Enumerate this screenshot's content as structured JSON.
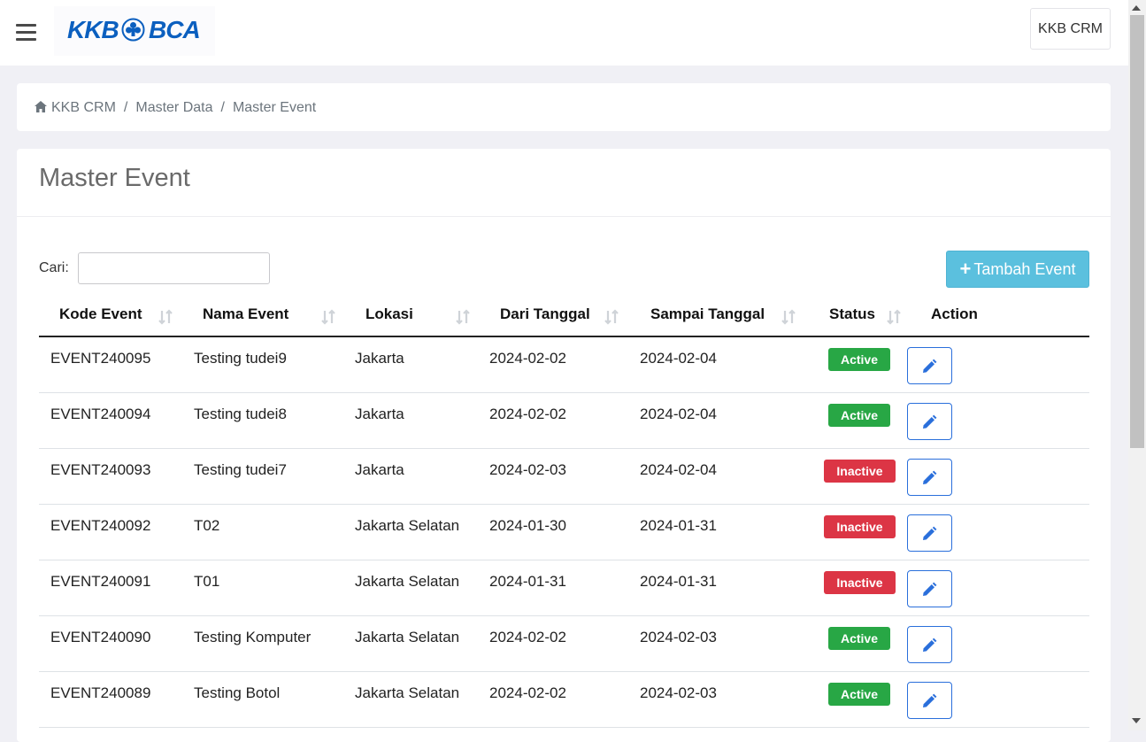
{
  "header": {
    "logo": {
      "left": "KKB",
      "right": "BCA"
    },
    "user_menu_label": "KKB CRM"
  },
  "breadcrumb": [
    "KKB CRM",
    "Master Data",
    "Master Event"
  ],
  "page": {
    "title": "Master Event",
    "search_label": "Cari:",
    "search_value": "",
    "add_button_label": "Tambah Event"
  },
  "table": {
    "headers": [
      "Kode Event",
      "Nama Event",
      "Lokasi",
      "Dari Tanggal",
      "Sampai Tanggal",
      "Status",
      "Action"
    ],
    "rows": [
      {
        "kode": "EVENT240095",
        "nama": "Testing tudei9",
        "lokasi": "Jakarta",
        "dari": "2024-02-02",
        "sampai": "2024-02-04",
        "status": "Active"
      },
      {
        "kode": "EVENT240094",
        "nama": "Testing tudei8",
        "lokasi": "Jakarta",
        "dari": "2024-02-02",
        "sampai": "2024-02-04",
        "status": "Active"
      },
      {
        "kode": "EVENT240093",
        "nama": "Testing tudei7",
        "lokasi": "Jakarta",
        "dari": "2024-02-03",
        "sampai": "2024-02-04",
        "status": "Inactive"
      },
      {
        "kode": "EVENT240092",
        "nama": "T02",
        "lokasi": "Jakarta Selatan",
        "dari": "2024-01-30",
        "sampai": "2024-01-31",
        "status": "Inactive"
      },
      {
        "kode": "EVENT240091",
        "nama": "T01",
        "lokasi": "Jakarta Selatan",
        "dari": "2024-01-31",
        "sampai": "2024-01-31",
        "status": "Inactive"
      },
      {
        "kode": "EVENT240090",
        "nama": "Testing Komputer",
        "lokasi": "Jakarta Selatan",
        "dari": "2024-02-02",
        "sampai": "2024-02-03",
        "status": "Active"
      },
      {
        "kode": "EVENT240089",
        "nama": "Testing Botol",
        "lokasi": "Jakarta Selatan",
        "dari": "2024-02-02",
        "sampai": "2024-02-03",
        "status": "Active"
      }
    ]
  },
  "colors": {
    "accent_info": "#5bc0de",
    "status_active": "#28a745",
    "status_inactive": "#dc3545",
    "edit_blue": "#2a6fdb",
    "logo_blue": "#0b5fbf"
  },
  "icons": {
    "menu": "hamburger-icon",
    "home": "home-icon",
    "sort": "sort-arrows-icon",
    "edit": "pencil-icon",
    "add": "plus-icon"
  }
}
